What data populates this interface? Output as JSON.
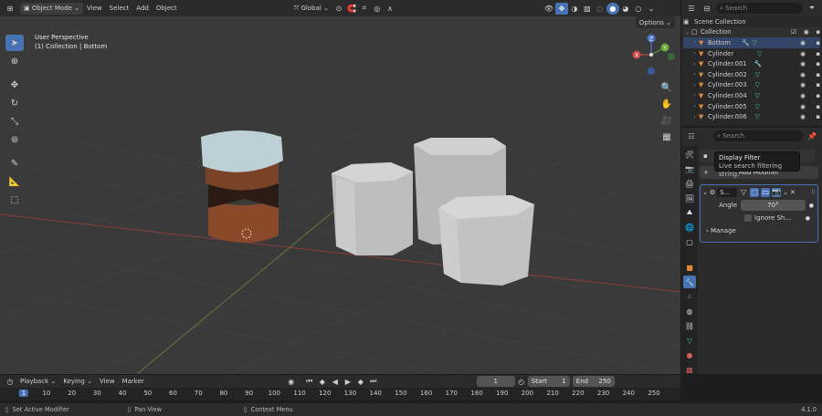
{
  "header": {
    "mode": "Object Mode",
    "menus": [
      "View",
      "Select",
      "Add",
      "Object"
    ],
    "transform_orientation": "Global",
    "options": "Options"
  },
  "viewport": {
    "title": "User Perspective",
    "subtitle": "(1) Collection | Bottom",
    "gizmo": {
      "z": "Z",
      "y": "Y",
      "x": "X"
    }
  },
  "outliner": {
    "search_placeholder": "Search",
    "scene_collection": "Scene Collection",
    "collection": "Collection",
    "items": [
      "Bottom",
      "Cylinder",
      "Cylinder.001",
      "Cylinder.002",
      "Cylinder.003",
      "Cylinder.004",
      "Cylinder.005",
      "Cylinder.006"
    ]
  },
  "properties": {
    "search_placeholder": "Search",
    "tooltip_title": "Display Filter",
    "tooltip_text": "Live search filtering string.",
    "add_modifier": "Add Modifier",
    "modifier_name": "S...",
    "angle_label": "Angle",
    "angle_value": "70°",
    "ignore_sharp": "Ignore Sh...",
    "manage": "Manage"
  },
  "timeline": {
    "menus": [
      "Playback",
      "Keying",
      "View",
      "Marker"
    ],
    "current_frame": "1",
    "start_label": "Start",
    "start_value": "1",
    "end_label": "End",
    "end_value": "250",
    "ticks": [
      "1",
      "10",
      "20",
      "30",
      "40",
      "50",
      "60",
      "70",
      "80",
      "90",
      "100",
      "110",
      "120",
      "130",
      "140",
      "150",
      "160",
      "170",
      "180",
      "190",
      "200",
      "210",
      "220",
      "230",
      "240",
      "250"
    ]
  },
  "statusbar": {
    "left": "Set Active Modifier",
    "middle": "Pan View",
    "right": "Context Menu",
    "version": "4.1.0"
  }
}
